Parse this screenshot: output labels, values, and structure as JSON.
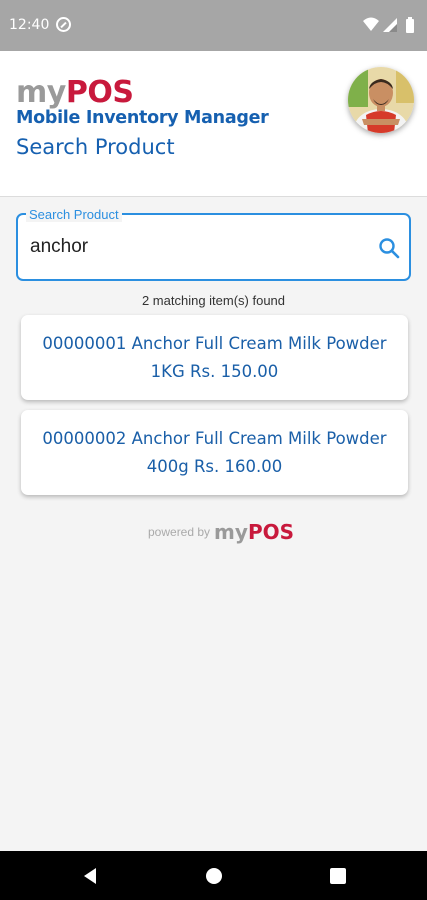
{
  "status_bar": {
    "time": "12:40"
  },
  "header": {
    "logo_my": "my",
    "logo_pos": "POS",
    "subtitle": "Mobile Inventory Manager",
    "page_title": "Search Product"
  },
  "search": {
    "label": "Search Product",
    "value": "anchor"
  },
  "results": {
    "summary": "2 matching item(s) found",
    "items": [
      {
        "text": "00000001  Anchor Full Cream Milk Powder 1KG Rs. 150.00"
      },
      {
        "text": "00000002  Anchor Full Cream Milk Powder 400g Rs. 160.00"
      }
    ]
  },
  "footer": {
    "powered_by": "powered by",
    "logo_my": "my",
    "logo_pos": "POS"
  },
  "colors": {
    "brand_blue": "#1660b0",
    "brand_red": "#c8193c",
    "accent": "#2b8fe0"
  },
  "icons": [
    "sync-icon",
    "wifi-icon",
    "signal-icon",
    "battery-icon",
    "search-icon",
    "back-icon",
    "home-icon",
    "recents-icon"
  ]
}
